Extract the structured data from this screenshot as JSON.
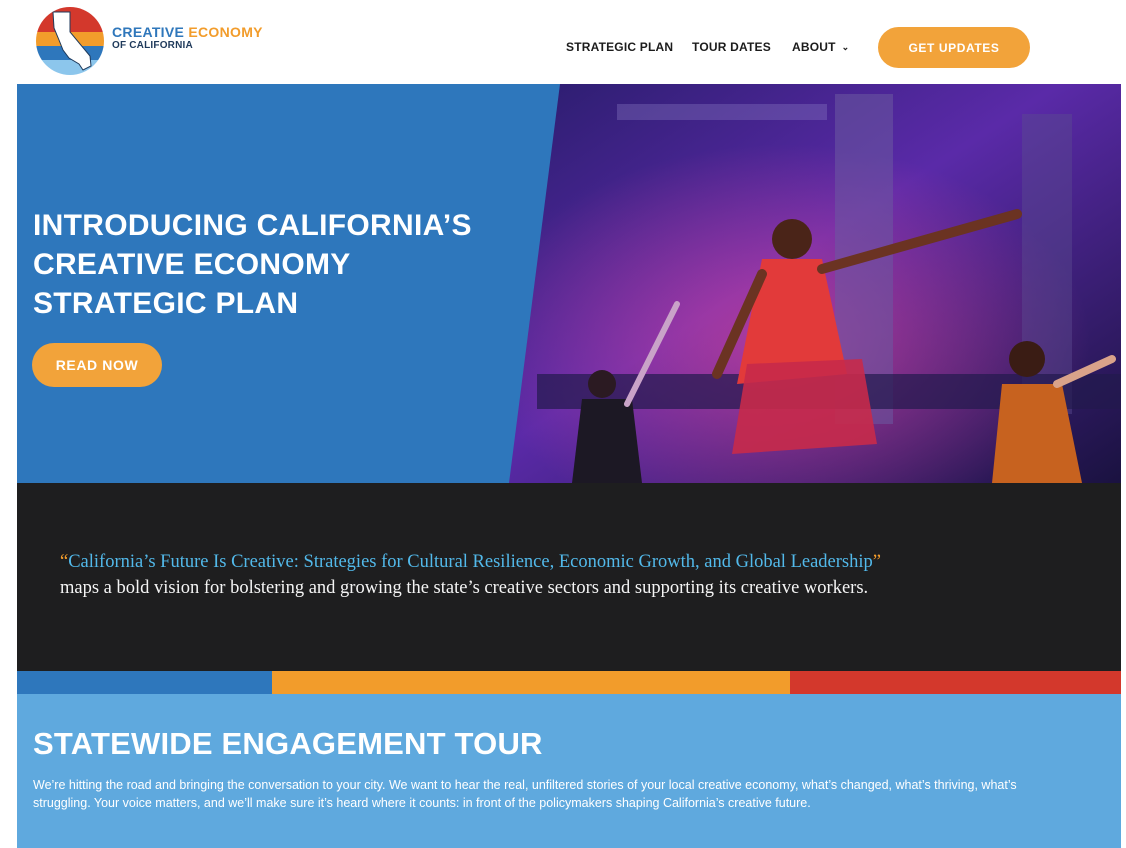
{
  "header": {
    "logo": {
      "line1_part1": "CREATIVE",
      "line1_part2": "ECONOMY",
      "line2": "OF CALIFORNIA"
    },
    "nav": {
      "strategic_plan": "STRATEGIC PLAN",
      "tour_dates": "TOUR DATES",
      "about": "ABOUT",
      "about_chevron": "⌄"
    },
    "cta": "GET UPDATES"
  },
  "hero": {
    "title_lines": [
      "INTRODUCING CALIFORNIA’S",
      "CREATIVE ECONOMY",
      "STRATEGIC PLAN"
    ],
    "button": "READ NOW"
  },
  "quote": {
    "open_mark": "“",
    "linked_title": "California’s Future Is Creative: Strategies for Cultural Resilience, Economic Growth, and Global Leadership",
    "close_mark": "”",
    "body": "maps a bold vision for bolstering and growing the state’s creative sectors and supporting its creative workers."
  },
  "tour": {
    "title": "STATEWIDE ENGAGEMENT TOUR",
    "body": "We’re hitting the road and bringing the conversation to your city. We want to hear the real, unfiltered stories of your local creative economy, what’s changed, what’s thriving, what’s struggling. Your voice matters, and we’ll make sure it’s heard where it counts: in front of the policymakers shaping California’s creative future."
  },
  "colors": {
    "blue": "#2e77bc",
    "orange": "#f29c2b",
    "red": "#d3382c",
    "light_blue": "#5fa9de",
    "dark": "#1e1e1f",
    "link_blue": "#52b9ea"
  },
  "icons": {
    "logo": "california-logo-icon",
    "chevron": "chevron-down-icon"
  }
}
